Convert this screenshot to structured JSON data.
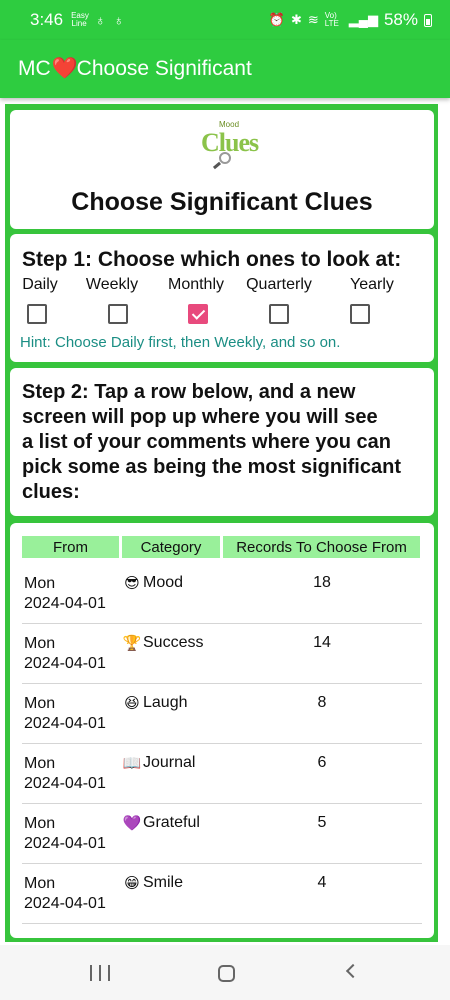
{
  "status_bar": {
    "time": "3:46",
    "easy_line": "Easy Line",
    "volte": "Vo) LTE",
    "battery": "58%"
  },
  "app_bar": {
    "prefix": "MC",
    "heart": "❤️",
    "title": "Choose Significant"
  },
  "logo": {
    "top_text": "Mood",
    "main_text": "Clues"
  },
  "header_card": {
    "title": "Choose Significant Clues"
  },
  "step1": {
    "title": "Step 1: Choose which ones to look at:",
    "periods": [
      {
        "label": "Daily",
        "checked": false
      },
      {
        "label": "Weekly",
        "checked": false
      },
      {
        "label": "Monthly",
        "checked": true
      },
      {
        "label": "Quarterly",
        "checked": false
      },
      {
        "label": "Yearly",
        "checked": false
      }
    ],
    "hint": "Hint: Choose Daily first, then Weekly, and so on."
  },
  "step2": {
    "lines": [
      "Step 2: Tap a row below, and a new",
      "screen will pop up where you will see",
      "a list of your comments where you can",
      "pick some as being the most significant",
      "clues:"
    ]
  },
  "table": {
    "headers": [
      "From",
      "Category",
      "Records To Choose From"
    ],
    "rows": [
      {
        "day": "Mon",
        "date": "2024-04-01",
        "icon": "😎",
        "category": "Mood",
        "count": "18"
      },
      {
        "day": "Mon",
        "date": "2024-04-01",
        "icon": "🏆",
        "category": "Success",
        "count": "14"
      },
      {
        "day": "Mon",
        "date": "2024-04-01",
        "icon": "😆",
        "category": "Laugh",
        "count": "8"
      },
      {
        "day": "Mon",
        "date": "2024-04-01",
        "icon": "📖",
        "category": "Journal",
        "count": "6"
      },
      {
        "day": "Mon",
        "date": "2024-04-01",
        "icon": "💜",
        "category": "Grateful",
        "count": "5"
      },
      {
        "day": "Mon",
        "date": "2024-04-01",
        "icon": "😁",
        "category": "Smile",
        "count": "4"
      }
    ]
  },
  "colors": {
    "brand_green": "#2ecc40",
    "header_green": "#99f09a",
    "check_pink": "#e84a7d",
    "hint_teal": "#1b8e84"
  }
}
